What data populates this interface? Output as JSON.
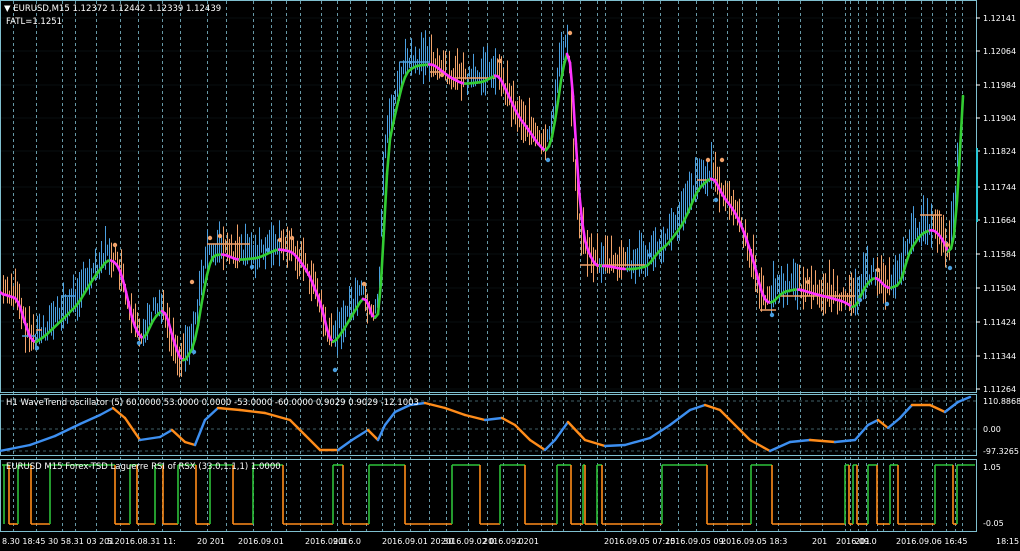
{
  "main": {
    "symbol_line": "▼ EURUSD,M15  1.12372 1.12442 1.12339 1.12439",
    "fatl_line": "FATL=1.1251",
    "price_ticks": [
      "1.12141",
      "1.12064",
      "1.11984",
      "1.11904",
      "1.11824",
      "1.11744",
      "1.11664",
      "1.11584",
      "1.11504",
      "1.11424",
      "1.11344",
      "1.11264"
    ]
  },
  "wave": {
    "title": "H1 WaveTrend oscillator (5) 60.0000 53.0000 0.0000 -53.0000 -60.0000 0.9029 0.9029 -12.1003",
    "ticks": [
      "110.8868",
      "0.00",
      "-97.3265"
    ]
  },
  "rsx": {
    "title": "EURUSD M15 Forex-TSD Laguerre RSI of RSX (33.0,1.1,1) 1.0000",
    "ticks": [
      "1.05",
      "-0.05"
    ]
  },
  "time_axis": {
    "labels": [
      "8.30 18:45",
      "30 5",
      "8.31 03 201",
      "5 2016.08.31 11:",
      "20 201",
      "2016.09.01",
      "2016.09.0",
      "2016.0",
      "2016.09.01 20:30",
      "2016.09.02 0:",
      "2016.09.0",
      "2 201",
      "2016.09.05 07:15",
      "2016.09.05 09:",
      "2016.09.05 18:3",
      "201",
      "2016.09.0",
      "201",
      "2016.09.06 16:45",
      "18:15"
    ]
  },
  "colors": {
    "grid": "#7fbfcf",
    "bull_bar": "#4a9fe0",
    "bear_bar": "#f2a36a",
    "fatl_up": "#33cc33",
    "fatl_dn": "#ff33ff",
    "stop_line": "#f2a36a",
    "wave_up": "#3d8ff0",
    "wave_dn": "#ff8c1a",
    "rsx_up": "#2ec23a",
    "rsx_dn": "#ff8c1a"
  }
}
